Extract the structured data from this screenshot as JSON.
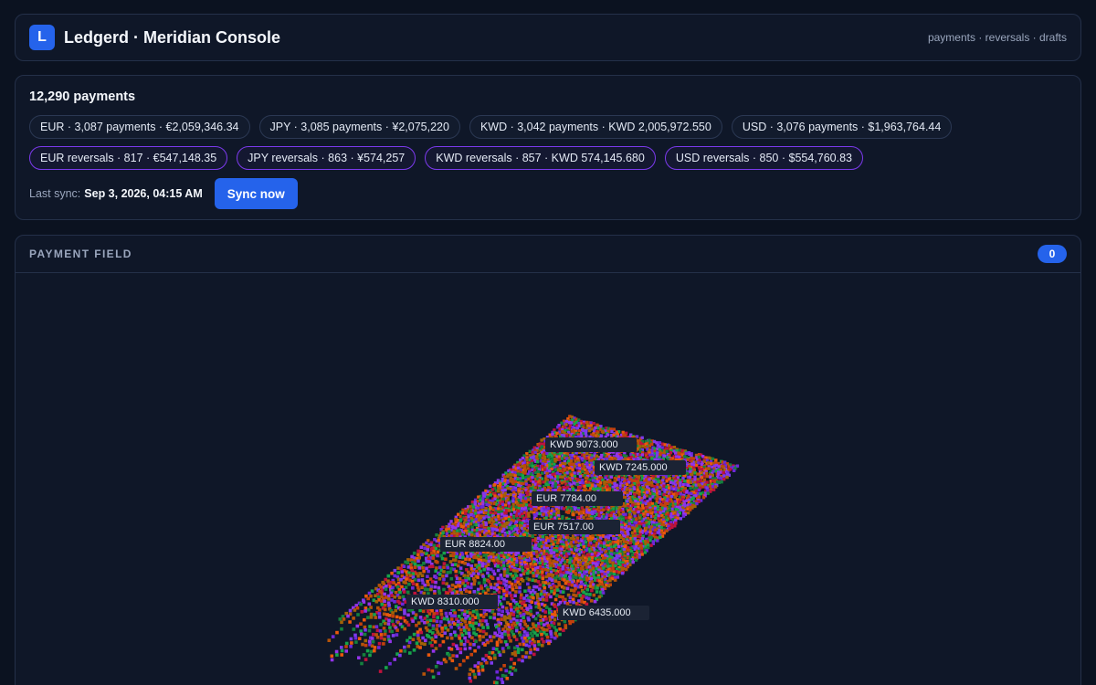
{
  "header": {
    "logo_letter": "L",
    "title": "Ledgerd · Meridian Console",
    "nav": "payments · reversals · drafts"
  },
  "summary": {
    "title": "12,290 payments",
    "payments": [
      {
        "label": "EUR · 3,087 payments · €2,059,346.34"
      },
      {
        "label": "JPY · 3,085 payments · ¥2,075,220"
      },
      {
        "label": "KWD · 3,042 payments · KWD 2,005,972.550"
      },
      {
        "label": "USD · 3,076 payments · $1,963,764.44"
      }
    ],
    "reversals": [
      {
        "label": "EUR reversals · 817 · €547,148.35"
      },
      {
        "label": "JPY reversals · 863 · ¥574,257"
      },
      {
        "label": "KWD reversals · 857 · KWD 574,145.680"
      },
      {
        "label": "USD reversals · 850 · $554,760.83"
      }
    ],
    "sync_label": "Last sync:",
    "sync_time": "Sep 3, 2026, 04:15 AM",
    "sync_button": "Sync now"
  },
  "field": {
    "title": "PAYMENT FIELD",
    "count": "0",
    "labels": [
      {
        "text": "KWD 9073.000"
      },
      {
        "text": "KWD 7245.000"
      },
      {
        "text": "EUR 7784.00"
      },
      {
        "text": "EUR 7517.00"
      },
      {
        "text": "EUR 8824.00"
      },
      {
        "text": "KWD 8310.000"
      },
      {
        "text": "KWD 6435.000"
      }
    ],
    "palette": [
      "#7c3aed",
      "#9333ea",
      "#c2410c",
      "#ea580c",
      "#15803d",
      "#16a34a",
      "#b45309",
      "#6d28d9",
      "#a16207",
      "#be123c"
    ]
  },
  "colors": {
    "accent": "#2563eb",
    "reversal_border": "#7c3aed"
  }
}
